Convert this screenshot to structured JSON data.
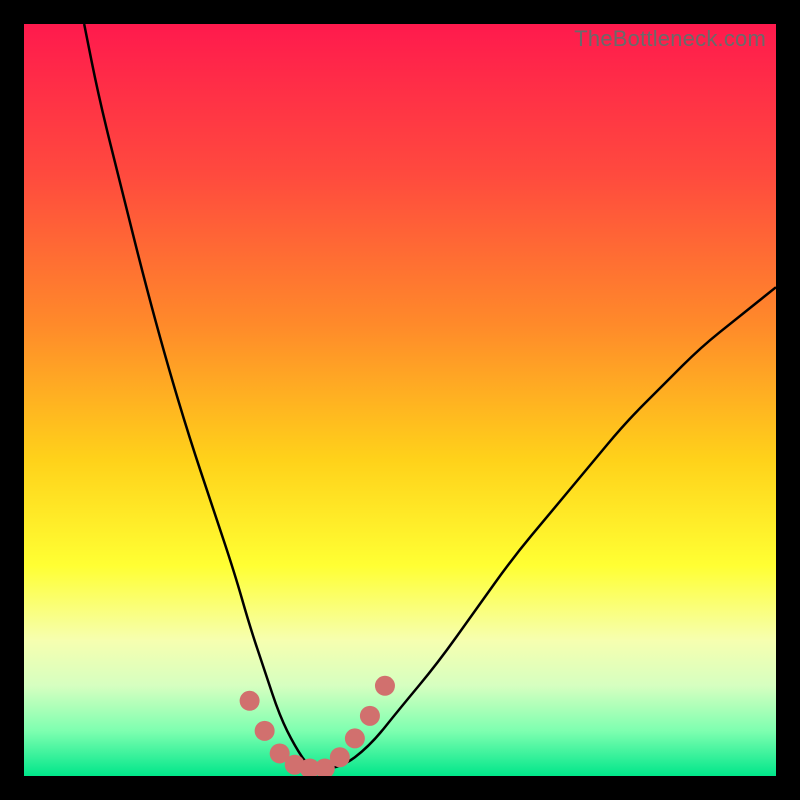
{
  "watermark": "TheBottleneck.com",
  "chart_data": {
    "type": "line",
    "title": "",
    "xlabel": "",
    "ylabel": "",
    "xlim": [
      0,
      100
    ],
    "ylim": [
      0,
      100
    ],
    "grid": false,
    "legend": false,
    "background_gradient": {
      "stops": [
        {
          "pos": 0.0,
          "color": "#ff1a4d"
        },
        {
          "pos": 0.2,
          "color": "#ff4a3e"
        },
        {
          "pos": 0.4,
          "color": "#ff8a2a"
        },
        {
          "pos": 0.58,
          "color": "#ffd21a"
        },
        {
          "pos": 0.72,
          "color": "#ffff33"
        },
        {
          "pos": 0.82,
          "color": "#f6ffb0"
        },
        {
          "pos": 0.88,
          "color": "#d6ffc0"
        },
        {
          "pos": 0.94,
          "color": "#7effb0"
        },
        {
          "pos": 1.0,
          "color": "#00e68a"
        }
      ]
    },
    "series": [
      {
        "name": "bottleneck-curve",
        "color": "#000000",
        "x": [
          8,
          10,
          13,
          16,
          19,
          22,
          25,
          28,
          30,
          32,
          34,
          36,
          38,
          42,
          46,
          50,
          55,
          60,
          65,
          70,
          75,
          80,
          85,
          90,
          95,
          100
        ],
        "values": [
          100,
          90,
          78,
          66,
          55,
          45,
          36,
          27,
          20,
          14,
          8,
          4,
          1,
          1,
          4,
          9,
          15,
          22,
          29,
          35,
          41,
          47,
          52,
          57,
          61,
          65
        ]
      }
    ],
    "markers": {
      "name": "highlight-dots",
      "color": "#d1706e",
      "radius": 10,
      "points": [
        {
          "x": 30,
          "y": 10
        },
        {
          "x": 32,
          "y": 6
        },
        {
          "x": 34,
          "y": 3
        },
        {
          "x": 36,
          "y": 1.5
        },
        {
          "x": 38,
          "y": 1
        },
        {
          "x": 40,
          "y": 1
        },
        {
          "x": 42,
          "y": 2.5
        },
        {
          "x": 44,
          "y": 5
        },
        {
          "x": 46,
          "y": 8
        },
        {
          "x": 48,
          "y": 12
        }
      ]
    }
  }
}
